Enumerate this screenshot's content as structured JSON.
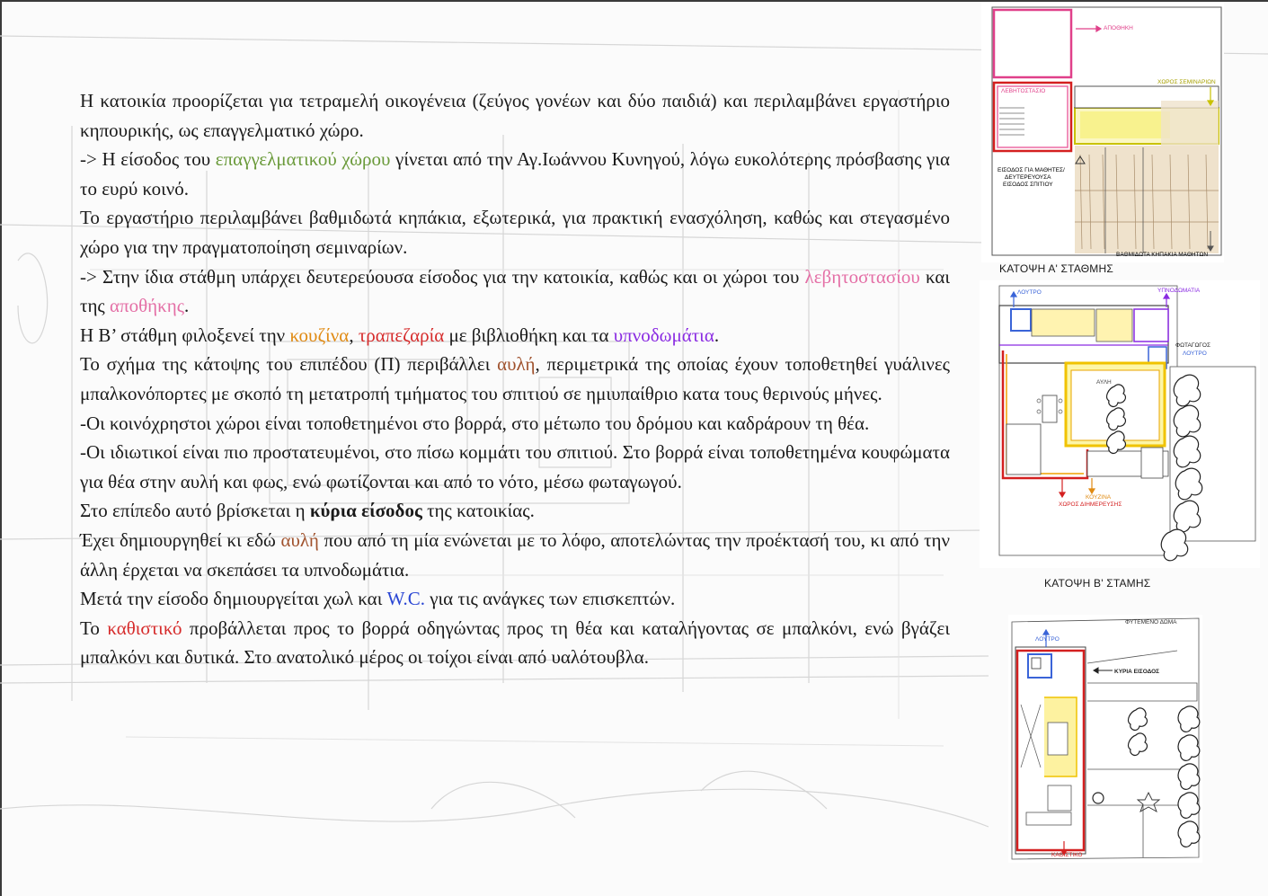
{
  "paragraphs": [
    {
      "segments": [
        {
          "text": "Η κατοικία προορίζεται για τετραμελή οικογένεια (ζεύγος γονέων και δύο παιδιά) και περιλαμβάνει εργαστήριο κηπουρικής, ως επαγγελματικό χώρο."
        }
      ]
    },
    {
      "segments": [
        {
          "text": "-> Η είσοδος του "
        },
        {
          "text": "επαγγελματικού χώρου",
          "color": "green"
        },
        {
          "text": " γίνεται από την Αγ.Ιωάννου Κυνηγού, λόγω ευκολότερης πρόσβασης για το ευρύ κοινό."
        }
      ]
    },
    {
      "segments": [
        {
          "text": "Το εργαστήριο περιλαμβάνει βαθμιδωτά κηπάκια, εξωτερικά, για πρακτική ενασχόληση, καθώς και στεγασμένο χώρο για την πραγματοποίηση σεμιναρίων."
        }
      ]
    },
    {
      "segments": [
        {
          "text": "-> Στην ίδια στάθμη υπάρχει δευτερεύουσα είσοδος για την κατοικία, καθώς και οι χώροι του "
        },
        {
          "text": "λεβητοστασίου",
          "color": "pink"
        },
        {
          "text": " και της "
        },
        {
          "text": "αποθήκης",
          "color": "pink"
        },
        {
          "text": "."
        }
      ]
    },
    {
      "segments": [
        {
          "text": "Η Β’ στάθμη φιλοξενεί την "
        },
        {
          "text": "κουζίνα",
          "color": "orange"
        },
        {
          "text": ", "
        },
        {
          "text": "τραπεζαρία",
          "color": "red"
        },
        {
          "text": " με βιβλιοθήκη και τα "
        },
        {
          "text": "υπνοδωμάτια",
          "color": "purple"
        },
        {
          "text": "."
        }
      ]
    },
    {
      "segments": [
        {
          "text": "Το σχήμα της κάτοψης του επιπέδου (Π) περιβάλλει "
        },
        {
          "text": "αυλή",
          "color": "brown"
        },
        {
          "text": ", περιμετρικά της οποίας έχουν τοποθετηθεί γυάλινες μπαλκονόπορτες με σκοπό τη μετατροπή τμήματος του σπιτιού σε ημιυπαίθριο κατα τους θερινούς μήνες."
        }
      ]
    },
    {
      "segments": [
        {
          "text": "-Οι κοινόχρηστοι χώροι είναι τοποθετημένοι στο βορρά, στο μέτωπο του δρόμου και καδράρουν τη θέα."
        }
      ]
    },
    {
      "segments": [
        {
          "text": "-Οι ιδιωτικοί είναι πιο προστατευμένοι, στο πίσω κομμάτι του σπιτιού. Στο βορρά είναι τοποθετημένα κουφώματα για θέα στην αυλή και φως, ενώ φωτίζονται και από το νότο, μέσω φωταγωγού."
        }
      ]
    },
    {
      "segments": [
        {
          "text": "Στο επίπεδο αυτό βρίσκεται η "
        },
        {
          "text": "κύρια είσοδος",
          "bold": true
        },
        {
          "text": " της κατοικίας."
        }
      ]
    },
    {
      "segments": [
        {
          "text": "Έχει δημιουργηθεί κι εδώ "
        },
        {
          "text": "αυλή",
          "color": "brown"
        },
        {
          "text": " που από τη μία ενώνεται με το λόφο, αποτελώντας την προέκτασή του, κι από την άλλη έρχεται να σκεπάσει τα υπνοδωμάτια."
        }
      ]
    },
    {
      "segments": [
        {
          "text": "Μετά την είσοδο δημιουργείται χωλ  και "
        },
        {
          "text": "W.C.",
          "color": "blue"
        },
        {
          "text": " για τις ανάγκες των επισκεπτών."
        }
      ]
    },
    {
      "segments": [
        {
          "text": "Το "
        },
        {
          "text": "καθιστικό",
          "color": "red"
        },
        {
          "text": " προβάλλεται προς το βορρά οδηγώντας προς τη θέα και καταλήγοντας σε μπαλκόνι, ενώ βγάζει μπαλκόνι και δυτικά. Στο ανατολικό μέρος οι τοίχοι είναι από υαλότουβλα."
        }
      ]
    }
  ],
  "colors": {
    "green": "#6a9a3a",
    "pink": "#e46fa6",
    "orange": "#e08a12",
    "red": "#d62b2b",
    "purple": "#8a2be2",
    "brown": "#a0522d",
    "blue": "#2b47d4"
  },
  "plan_a": {
    "caption": "ΚΑΤΟΨΗ Α' ΣΤΑΘΜΗΣ",
    "labels": {
      "storage": "ΑΠΟΘΗΚΗ",
      "boiler_room": "ΛΕΒΗΤΟΣΤΑΣΙΟ",
      "seminar_room": "ΧΩΡΟΣ ΣΕΜΙΝΑΡΙΩΝ",
      "entrance_line1": "ΕΙΣΟΔΟΣ ΓΙΑ ΜΑΘΗΤΕΣ/",
      "entrance_line2": "ΔΕΥΤΕΡΕΥΟΥΣΑ",
      "entrance_line3": "ΕΙΣΟΔΟΣ ΣΠΙΤΙΟΥ",
      "gardens": "ΒΑΘΜΙΔΩΤΑ ΚΗΠΑΚΙΑ ΜΑΘΗΤΩΝ"
    }
  },
  "plan_b": {
    "caption": "ΚΑΤΟΨΗ Β' ΣΤΑΜΗΣ",
    "labels": {
      "bathroom": "ΛΟΥΤΡΟ",
      "bedrooms": "ΥΠΝΟΔΩΜΑΤΙΑ",
      "lightwell": "ΦΩΤΑΓΩΓΟΣ",
      "bathroom2": "ΛΟΥΤΡΟ",
      "courtyard": "ΑΥΛΗ",
      "kitchen": "ΚΟΥΖΙΝΑ",
      "dining": "ΧΩΡΟΣ ΔΙΗΜΕΡΕΥΣΗΣ"
    }
  },
  "plan_c": {
    "labels": {
      "roof": "ΦΥΤΕΜΕΝΟ ΔΩΜΑ",
      "bathroom": "ΛΟΥΤΡΟ",
      "main_entrance": "ΚΥΡΙΑ ΕΙΣΟΔΟΣ",
      "living": "ΚΑΘΙΣΤΙΚΟ"
    }
  }
}
